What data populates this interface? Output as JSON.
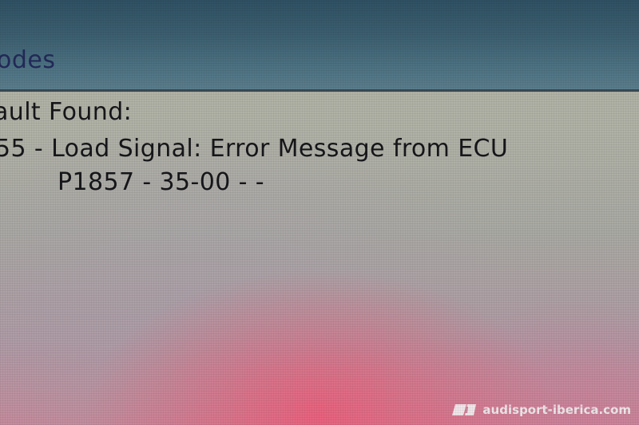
{
  "window": {
    "header_title": "odes"
  },
  "fault": {
    "heading": "ault Found:",
    "description": "55 - Load Signal: Error Message from ECU",
    "code": "P1857 - 35-00 - -"
  },
  "watermark": {
    "text": "audisport-iberica.com",
    "logo_icon": "audisport-logo-icon"
  },
  "colors": {
    "header_bar": "#3c5f70",
    "header_text": "#232a5a",
    "fault_text": "#16161a",
    "screen_background": "#b0b2a6",
    "glare": "#f05a78"
  }
}
